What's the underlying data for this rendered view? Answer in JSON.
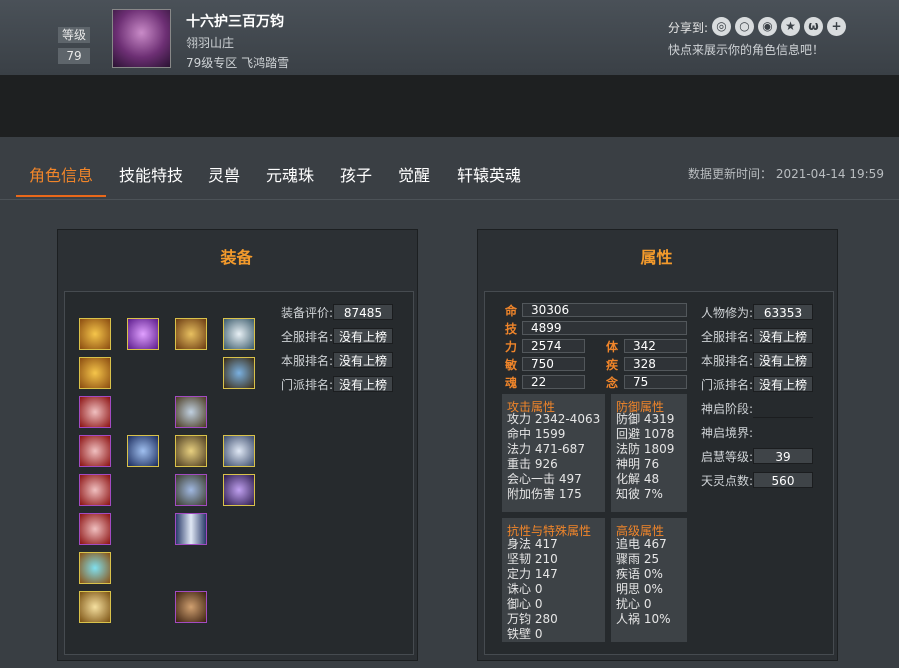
{
  "header": {
    "level_label": "等级",
    "level_value": "79",
    "character_name": "十六护三百万钧",
    "guild": "翎羽山庄",
    "server": "79级专区 飞鸿踏雪",
    "share_label": "分享到:",
    "share_icons": [
      "wechat-icon",
      "qq-icon",
      "weibo-icon",
      "star-icon",
      "tencent-weibo-icon",
      "plus-icon"
    ],
    "share_tip": "快点来展示你的角色信息吧！"
  },
  "tabs": [
    {
      "label": "角色信息",
      "active": true
    },
    {
      "label": "技能特技"
    },
    {
      "label": "灵兽"
    },
    {
      "label": "元魂珠"
    },
    {
      "label": "孩子"
    },
    {
      "label": "觉醒"
    },
    {
      "label": "轩辕英魂"
    }
  ],
  "update_time": "数据更新时间： 2021-04-14 19:59",
  "equipment": {
    "title": "装备",
    "score_label": "装备评价:",
    "score_value": "87485",
    "rank_all_label": "全服排名:",
    "rank_all_value": "没有上榜",
    "rank_server_label": "本服排名:",
    "rank_server_value": "没有上榜",
    "rank_sect_label": "门派排名:",
    "rank_sect_value": "没有上榜"
  },
  "attributes": {
    "title": "属性",
    "ming_label": "命",
    "ming_value": "30306",
    "ji_label": "技",
    "ji_value": "4899",
    "li_label": "力",
    "li_value": "2574",
    "ti_label": "体",
    "ti_value": "342",
    "min_label": "敏",
    "min_value": "750",
    "ji2_label": "疾",
    "ji2_value": "328",
    "hun_label": "魂",
    "hun_value": "22",
    "nian_label": "念",
    "nian_value": "75",
    "attack_title": "攻击属性",
    "attack_lines": [
      "攻力 2342-4063",
      "命中 1599",
      "法力 471-687",
      "重击 926",
      "会心一击 497",
      "附加伤害 175"
    ],
    "defense_title": "防御属性",
    "defense_lines": [
      "防御 4319",
      "回避 1078",
      "法防 1809",
      "神明 76",
      "化解 48",
      "知彼 7%"
    ],
    "resist_title": "抗性与特殊属性",
    "resist_lines": [
      "身法 417",
      "坚韧 210",
      "定力 147",
      "诛心 0",
      "御心 0",
      "万钧 280",
      "铁壁 0"
    ],
    "advanced_title": "高级属性",
    "advanced_lines": [
      "追电 467",
      "骤雨 25",
      "疾语 0%",
      "明思 0%",
      "扰心 0",
      "人祸 10%"
    ],
    "cultivation_label": "人物修为:",
    "cultivation_value": "63353",
    "rank_all_label": "全服排名:",
    "rank_all_value": "没有上榜",
    "rank_server_label": "本服排名:",
    "rank_server_value": "没有上榜",
    "rank_sect_label": "门派排名:",
    "rank_sect_value": "没有上榜",
    "shenqi_stage_label": "神启阶段:",
    "shenqi_stage_value": "",
    "shenqi_realm_label": "神启境界:",
    "wisdom_label": "启慧等级:",
    "wisdom_value": "39",
    "spirit_label": "天灵点数:",
    "spirit_value": "560"
  }
}
